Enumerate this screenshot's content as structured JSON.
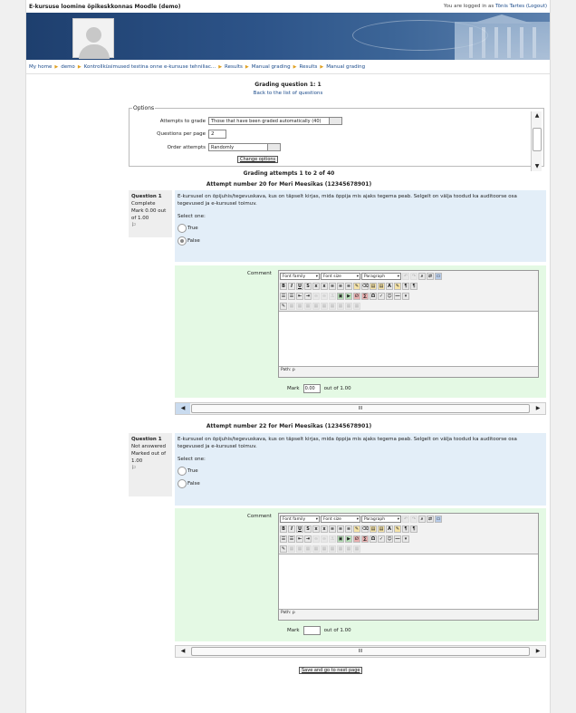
{
  "header": {
    "site_title": "E-kursuse loomine õpikeskkonnas Moodle (demo)",
    "login_prefix": "You are logged in as",
    "user": "Tõnis Tartes",
    "logout": "(Logout)"
  },
  "breadcrumb": [
    "My home",
    "demo",
    "Kontrollküsimused testina onne e-kursuse tehniliac...",
    "Results",
    "Manual grading",
    "Results",
    "Manual grading"
  ],
  "grading": {
    "title": "Grading question 1: 1",
    "back_link": "Back to the list of questions"
  },
  "options": {
    "legend": "Options",
    "attempts_label": "Attempts to grade",
    "attempts_value": "Those that have been graded automatically (40)",
    "per_page_label": "Questions per page",
    "per_page_value": "2",
    "order_label": "Order attempts",
    "order_value": "Randomly",
    "change_button": "Change options"
  },
  "attempts_title": "Grading attempts 1 to 2 of 40",
  "attempts": [
    {
      "heading": "Attempt number 20 for Meri Meesikas (12345678901)",
      "question_label": "Question 1",
      "state": "Complete",
      "mark_info": "Mark 0.00 out of 1.00",
      "text": "E-kursusel on õpijuhis/tegevuskava, kus on täpselt kirjas, mida õppija mis ajaks tegema peab. Selgelt on välja toodud ka auditoorse osa tegevused ja e-kursusel toimuv.",
      "select_label": "Select one:",
      "options": [
        "True",
        "False"
      ],
      "selected": 1,
      "comment_label": "Comment",
      "path": "Path: p",
      "mark_label": "Mark",
      "mark_value": "0.00",
      "out_of": "out of 1.00"
    },
    {
      "heading": "Attempt number 22 for Meri Meesikas (12345678901)",
      "question_label": "Question 1",
      "state": "Not answered",
      "mark_info": "Marked out of 1.00",
      "text": "E-kursusel on õpijuhis/tegevuskava, kus on täpselt kirjas, mida õppija mis ajaks tegema peab. Selgelt on välja toodud ka auditoorse osa tegevused ja e-kursusel toimuv.",
      "select_label": "Select one:",
      "options": [
        "True",
        "False"
      ],
      "selected": -1,
      "comment_label": "Comment",
      "path": "Path: p",
      "mark_label": "Mark",
      "mark_value": "",
      "out_of": "out of 1.00"
    }
  ],
  "editor": {
    "font_family": "Font family",
    "font_size": "Font size",
    "paragraph": "Paragraph"
  },
  "save_button": "Save and go to next page",
  "scroll_grip": "III"
}
